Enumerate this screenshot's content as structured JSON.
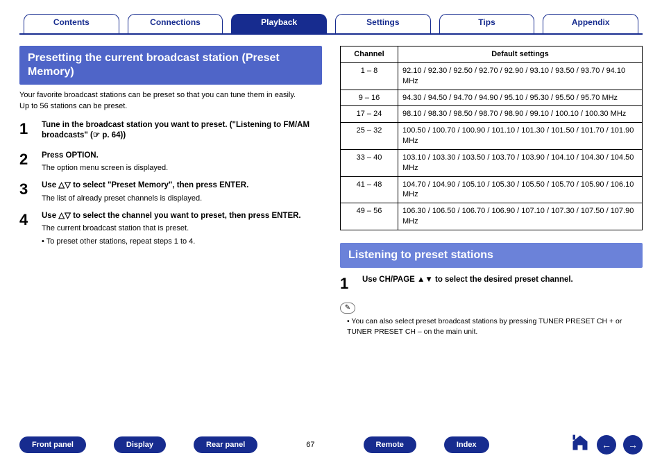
{
  "tabs": [
    "Contents",
    "Connections",
    "Playback",
    "Settings",
    "Tips",
    "Appendix"
  ],
  "active_tab": 2,
  "left": {
    "heading": "Presetting the current broadcast station (Preset Memory)",
    "intro1": "Your favorite broadcast stations can be preset so that you can tune them in easily.",
    "intro2": "Up to 56 stations can be preset.",
    "steps": [
      {
        "n": "1",
        "title": "Tune in the broadcast station you want to preset. (\"Listening to FM/AM broadcasts\" (☞ p. 64))",
        "sub": "",
        "bullet": ""
      },
      {
        "n": "2",
        "title": "Press OPTION.",
        "sub": "The option menu screen is displayed.",
        "bullet": ""
      },
      {
        "n": "3",
        "title": "Use △▽ to select \"Preset Memory\", then press ENTER.",
        "sub": "The list of already preset channels is displayed.",
        "bullet": ""
      },
      {
        "n": "4",
        "title": "Use △▽ to select the channel you want to preset, then press ENTER.",
        "sub": "The current broadcast station that is preset.",
        "bullet": "To preset other stations, repeat steps 1 to 4."
      }
    ]
  },
  "table": {
    "head_channel": "Channel",
    "head_default": "Default settings",
    "rows": [
      {
        "ch": "1 – 8",
        "v": "92.10 / 92.30 / 92.50 / 92.70 / 92.90 / 93.10 / 93.50 / 93.70 / 94.10 MHz"
      },
      {
        "ch": "9 – 16",
        "v": "94.30 / 94.50 / 94.70 / 94.90 / 95.10 / 95.30 / 95.50 / 95.70 MHz"
      },
      {
        "ch": "17 – 24",
        "v": "98.10 / 98.30 / 98.50 / 98.70 / 98.90 / 99.10 / 100.10 / 100.30 MHz"
      },
      {
        "ch": "25 – 32",
        "v": "100.50 / 100.70 / 100.90 / 101.10 / 101.30 / 101.50 / 101.70 / 101.90 MHz"
      },
      {
        "ch": "33 – 40",
        "v": "103.10 / 103.30 / 103.50 / 103.70 / 103.90 / 104.10 / 104.30 / 104.50 MHz"
      },
      {
        "ch": "41 – 48",
        "v": "104.70 / 104.90 / 105.10 / 105.30 / 105.50 / 105.70 / 105.90 / 106.10 MHz"
      },
      {
        "ch": "49 – 56",
        "v": "106.30 / 106.50 / 106.70 / 106.90 / 107.10 / 107.30 / 107.50 / 107.90 MHz"
      }
    ]
  },
  "right": {
    "heading": "Listening to preset stations",
    "step": {
      "n": "1",
      "title": "Use CH/PAGE ▲▼ to select the desired preset channel."
    },
    "note_icon": "✎",
    "note": "You can also select preset broadcast stations by pressing TUNER PRESET CH + or TUNER PRESET CH – on the main unit."
  },
  "bottom": {
    "buttons": [
      "Front panel",
      "Display",
      "Rear panel"
    ],
    "page": "67",
    "buttons2": [
      "Remote",
      "Index"
    ]
  }
}
